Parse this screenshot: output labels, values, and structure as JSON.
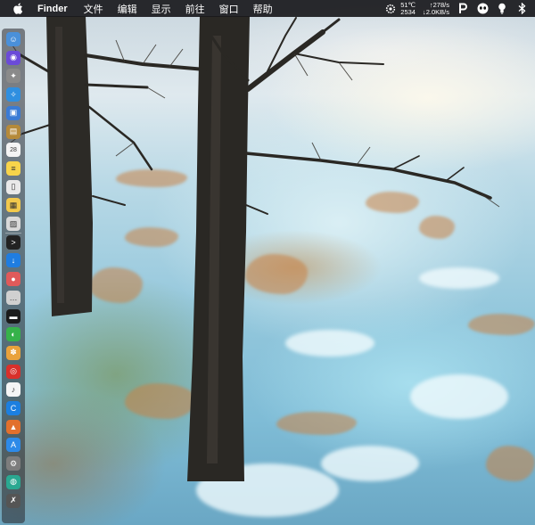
{
  "menubar": {
    "app_name": "Finder",
    "menus": [
      "文件",
      "编辑",
      "显示",
      "前往",
      "窗口",
      "帮助"
    ],
    "status": {
      "temperature": "51℃",
      "fan_speed": "2534",
      "upload_speed": "↑278/s",
      "download_speed": "↓2.0KB/s"
    }
  },
  "dock": {
    "items": [
      {
        "name": "finder-icon",
        "color": "#4a90d9",
        "glyph": "☺"
      },
      {
        "name": "siri-icon",
        "color": "#6b4bd8",
        "glyph": "◉"
      },
      {
        "name": "launchpad-icon",
        "color": "#8a8a8a",
        "glyph": "✦"
      },
      {
        "name": "safari-icon",
        "color": "#2f8fe0",
        "glyph": "✧"
      },
      {
        "name": "photo-icon",
        "color": "#3a7bd5",
        "glyph": "▣"
      },
      {
        "name": "notebook-icon",
        "color": "#b58a3a",
        "glyph": "▤"
      },
      {
        "name": "calendar-icon",
        "color": "#f4f4f4",
        "glyph": "28"
      },
      {
        "name": "notes-icon",
        "color": "#f7d44a",
        "glyph": "≡"
      },
      {
        "name": "document-icon",
        "color": "#e9e9e9",
        "glyph": "▯"
      },
      {
        "name": "stickies-icon",
        "color": "#f2c94c",
        "glyph": "▦"
      },
      {
        "name": "preview-icon",
        "color": "#d9d9d9",
        "glyph": "▨"
      },
      {
        "name": "terminal-icon",
        "color": "#222222",
        "glyph": ">"
      },
      {
        "name": "app-store-download-icon",
        "color": "#1f7de0",
        "glyph": "↓"
      },
      {
        "name": "colorful-app-icon",
        "color": "#e05a5a",
        "glyph": "●"
      },
      {
        "name": "messages-icon",
        "color": "#d0d0d0",
        "glyph": "…"
      },
      {
        "name": "activity-monitor-icon",
        "color": "#1b1b1b",
        "glyph": "▬"
      },
      {
        "name": "wechat-icon",
        "color": "#36b24a",
        "glyph": "◐"
      },
      {
        "name": "pinwheel-icon",
        "color": "#e9a23b",
        "glyph": "✽"
      },
      {
        "name": "netease-music-icon",
        "color": "#d9302b",
        "glyph": "◎"
      },
      {
        "name": "itunes-icon",
        "color": "#f5f5f5",
        "glyph": "♪"
      },
      {
        "name": "qq-browser-icon",
        "color": "#1c7fe0",
        "glyph": "C"
      },
      {
        "name": "orange-app-icon",
        "color": "#e2702d",
        "glyph": "▲"
      },
      {
        "name": "app-store-icon",
        "color": "#2d8ae8",
        "glyph": "A"
      },
      {
        "name": "system-preferences-icon",
        "color": "#7d7d7d",
        "glyph": "⚙"
      },
      {
        "name": "teal-app-icon",
        "color": "#2aa891",
        "glyph": "◍"
      },
      {
        "name": "utility-app-icon",
        "color": "#555555",
        "glyph": "✗"
      }
    ]
  }
}
